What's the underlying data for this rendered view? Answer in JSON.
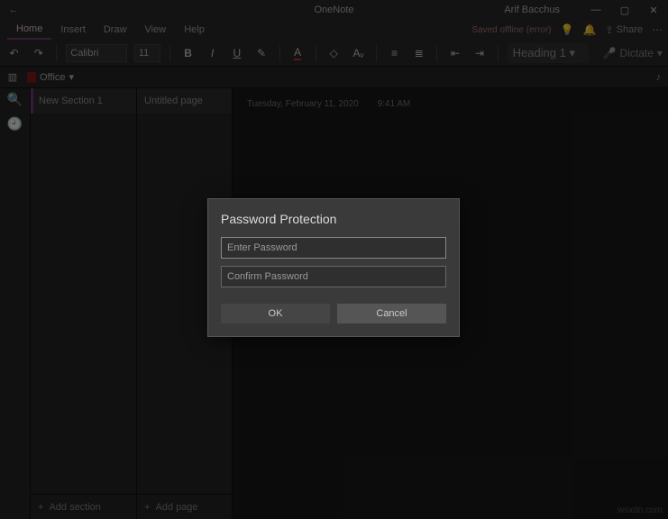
{
  "titlebar": {
    "app_title": "OneNote",
    "user_name": "Arif Bacchus"
  },
  "tabs": {
    "items": [
      "Home",
      "Insert",
      "Draw",
      "View",
      "Help"
    ],
    "active_index": 0,
    "status_text": "Saved offline (error)",
    "share_label": "Share"
  },
  "ribbon": {
    "font_name": "Calibri",
    "font_size": "11",
    "heading_style": "Heading 1",
    "dictate_label": "Dictate"
  },
  "notebook": {
    "name": "Office",
    "chevron": "▾"
  },
  "sections": {
    "items": [
      "New Section 1"
    ],
    "add_label": "Add section"
  },
  "pages": {
    "items": [
      "Untitled page"
    ],
    "add_label": "Add page"
  },
  "canvas": {
    "date": "Tuesday, February 11, 2020",
    "time": "9:41 AM"
  },
  "dialog": {
    "title": "Password Protection",
    "enter_placeholder": "Enter Password",
    "confirm_placeholder": "Confirm Password",
    "ok_label": "OK",
    "cancel_label": "Cancel"
  },
  "watermark": "wsxdn.com"
}
